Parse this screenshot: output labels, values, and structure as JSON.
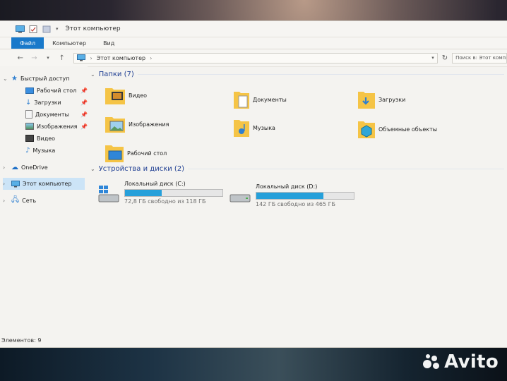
{
  "window": {
    "title": "Этот компьютер",
    "accent": "#1979ca"
  },
  "ribbon": {
    "tabs": [
      "Файл",
      "Компьютер",
      "Вид"
    ]
  },
  "address": {
    "path": "Этот компьютер",
    "search_placeholder": "Поиск в: Этот компь"
  },
  "nav": {
    "quick_access": "Быстрый доступ",
    "items": [
      {
        "label": "Рабочий стол",
        "icon": "desktop-icon",
        "pinned": true
      },
      {
        "label": "Загрузки",
        "icon": "downloads-icon",
        "pinned": true
      },
      {
        "label": "Документы",
        "icon": "documents-icon",
        "pinned": true
      },
      {
        "label": "Изображения",
        "icon": "pictures-icon",
        "pinned": true
      },
      {
        "label": "Видео",
        "icon": "video-icon",
        "pinned": false
      },
      {
        "label": "Музыка",
        "icon": "music-icon",
        "pinned": false
      }
    ],
    "onedrive": "OneDrive",
    "this_pc": "Этот компьютер",
    "network": "Сеть"
  },
  "folders": {
    "header": "Папки (7)",
    "items": [
      {
        "label": "Видео"
      },
      {
        "label": "Документы"
      },
      {
        "label": "Загрузки"
      },
      {
        "label": "Изображения"
      },
      {
        "label": "Музыка"
      },
      {
        "label": "Объемные объекты"
      },
      {
        "label": "Рабочий стол"
      }
    ]
  },
  "devices": {
    "header": "Устройства и диски (2)",
    "drives": [
      {
        "name": "Локальный диск (C:)",
        "free_text": "72,8 ГБ свободно из 118 ГБ",
        "used_fraction": 0.38
      },
      {
        "name": "Локальный диск (D:)",
        "free_text": "142 ГБ свободно из 465 ГБ",
        "used_fraction": 0.69
      }
    ]
  },
  "status": {
    "text": "Элементов: 9"
  },
  "watermark": "Avito"
}
